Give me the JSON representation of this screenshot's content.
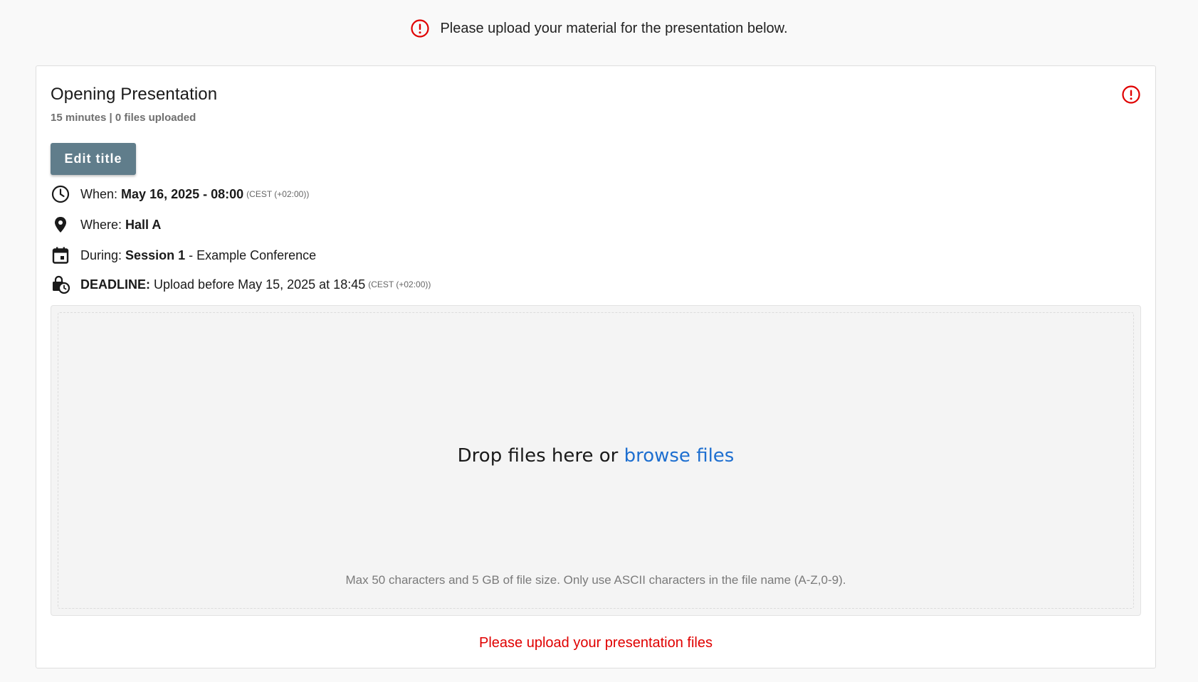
{
  "banner": {
    "message": "Please upload your material for the presentation below.",
    "icon": "alert-circle-icon",
    "icon_color": "#e00000"
  },
  "presentation": {
    "title": "Opening Presentation",
    "subtitle": "15 minutes | 0 files uploaded",
    "status_icon": "alert-circle-icon",
    "edit_button_label": "Edit title",
    "when": {
      "label": "When:",
      "value": "May 16, 2025 - 08:00",
      "timezone": "(CEST (+02:00))",
      "icon": "clock-icon"
    },
    "where": {
      "label": "Where:",
      "value": "Hall A",
      "icon": "location-pin-icon"
    },
    "during": {
      "label": "During:",
      "session": "Session 1",
      "rest": " - Example Conference",
      "icon": "calendar-icon"
    },
    "deadline": {
      "label": "DEADLINE:",
      "value": "Upload before May 15, 2025 at 18:45",
      "timezone": "(CEST (+02:00))",
      "icon": "lock-clock-icon"
    }
  },
  "dropzone": {
    "text_before": "Drop files here or ",
    "browse_link": "browse files",
    "note": "Max 50 characters and 5 GB of file size. Only use ASCII characters in the file name (A-Z,0-9)."
  },
  "bottom_message": "Please upload your presentation files",
  "colors": {
    "accent_button": "#607d8b",
    "error": "#e00000",
    "link": "#1e6fd0"
  }
}
